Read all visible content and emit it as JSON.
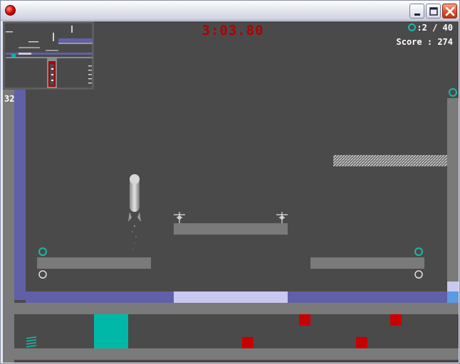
{
  "window": {
    "controls": [
      "minimize",
      "maximize",
      "close"
    ]
  },
  "hud": {
    "timer": "3:03.80",
    "collected": "2 / 40",
    "score_label": "Score",
    "score_value": "274",
    "depth_value": "32"
  },
  "icons": {
    "app": "red-ball-icon",
    "collectible": "teal-ring-icon",
    "empty_slot": "white-ring-icon",
    "spring": "spring-icon",
    "lamp": "lamp-icon"
  },
  "colors": {
    "background": "#4a4a4a",
    "wall_purple": "#6060a8",
    "wall_gray": "#7a7a7a",
    "glow_strip": "#c8c8f0",
    "teal_block": "#00b8a8",
    "hazard_red": "#c80000",
    "ring_teal": "#1ab8aa",
    "timer_red": "#b00000"
  }
}
